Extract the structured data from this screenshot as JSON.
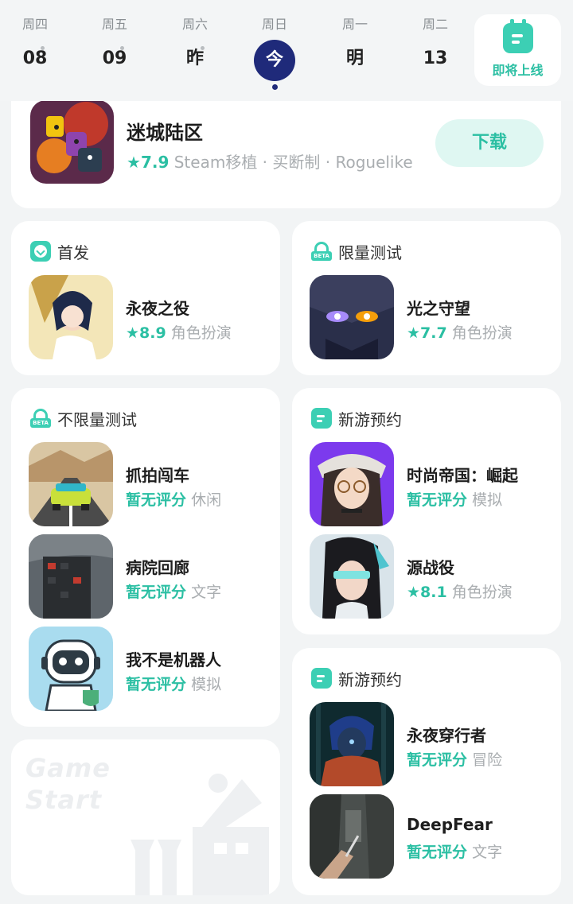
{
  "datebar": {
    "days": [
      {
        "weekday": "周四",
        "label": "08"
      },
      {
        "weekday": "周五",
        "label": "09"
      },
      {
        "weekday": "周六",
        "label": "昨"
      },
      {
        "weekday": "周日",
        "label": "今"
      },
      {
        "weekday": "周一",
        "label": "明"
      },
      {
        "weekday": "周二",
        "label": "13"
      }
    ],
    "upcoming_label": "即将上线"
  },
  "hero": {
    "title": "迷城陆区",
    "rating": "7.9",
    "tags": "Steam移植 · 买断制 · Roguelike",
    "download_label": "下载"
  },
  "sections": [
    {
      "title": "首发",
      "icon": "download-icon",
      "games": [
        {
          "name": "永夜之役",
          "rating": "8.9",
          "genre": "角色扮演"
        }
      ]
    },
    {
      "title": "限量测试",
      "icon": "beta-icon",
      "games": [
        {
          "name": "光之守望",
          "rating": "7.7",
          "genre": "角色扮演"
        }
      ]
    },
    {
      "title": "不限量测试",
      "icon": "beta-icon",
      "games": [
        {
          "name": "抓拍闯车",
          "rating": "暂无评分",
          "genre": "休闲"
        },
        {
          "name": "病院回廊",
          "rating": "暂无评分",
          "genre": "文字"
        },
        {
          "name": "我不是机器人",
          "rating": "暂无评分",
          "genre": "模拟"
        }
      ]
    },
    {
      "title": "新游预约",
      "icon": "calendar-icon",
      "games": [
        {
          "name": "时尚帝国：崛起",
          "rating": "暂无评分",
          "genre": "模拟"
        },
        {
          "name": "源战役",
          "rating": "8.1",
          "genre": "角色扮演"
        }
      ]
    },
    {
      "title": "新游预约",
      "icon": "calendar-icon",
      "games": [
        {
          "name": "永夜穿行者",
          "rating": "暂无评分",
          "genre": "冒险"
        },
        {
          "name": "DeepFear",
          "rating": "暂无评分",
          "genre": "文字"
        }
      ]
    }
  ],
  "promo": {
    "line1": "Game",
    "line2": "Start"
  },
  "colors": {
    "accent": "#3ccfb4",
    "accent_text": "#2bbfa3",
    "today": "#1f2a7a",
    "background": "#f2f4f5"
  },
  "star_glyph": "★"
}
